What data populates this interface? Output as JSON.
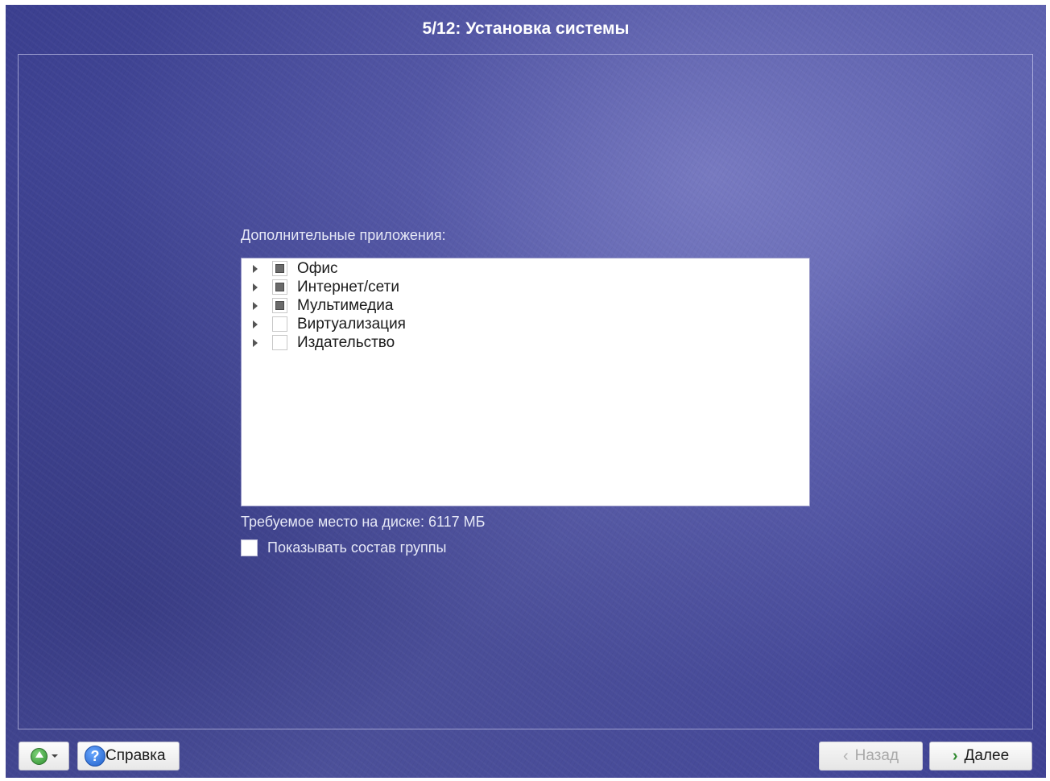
{
  "window": {
    "title": "5/12: Установка системы"
  },
  "main": {
    "section_label": "Дополнительные приложения:",
    "groups": [
      {
        "label": "Офис",
        "state": "partial"
      },
      {
        "label": "Интернет/сети",
        "state": "partial"
      },
      {
        "label": "Мультимедиа",
        "state": "partial"
      },
      {
        "label": "Виртуализация",
        "state": "unchecked"
      },
      {
        "label": "Издательство",
        "state": "unchecked"
      }
    ],
    "disk_space": "Требуемое место на диске: 6117 МБ",
    "show_group_label": "Показывать состав группы",
    "show_group_checked": false
  },
  "footer": {
    "help_label": "Справка",
    "back_label": "Назад",
    "next_label": "Далее"
  },
  "icons": {
    "menu": "up-arrow-icon",
    "help": "help-icon",
    "back": "chevron-left-icon",
    "next": "chevron-right-icon"
  },
  "colors": {
    "background": "#4a4f9e",
    "text_light": "#e6e8f6",
    "accent_green": "#2f8a2f"
  }
}
